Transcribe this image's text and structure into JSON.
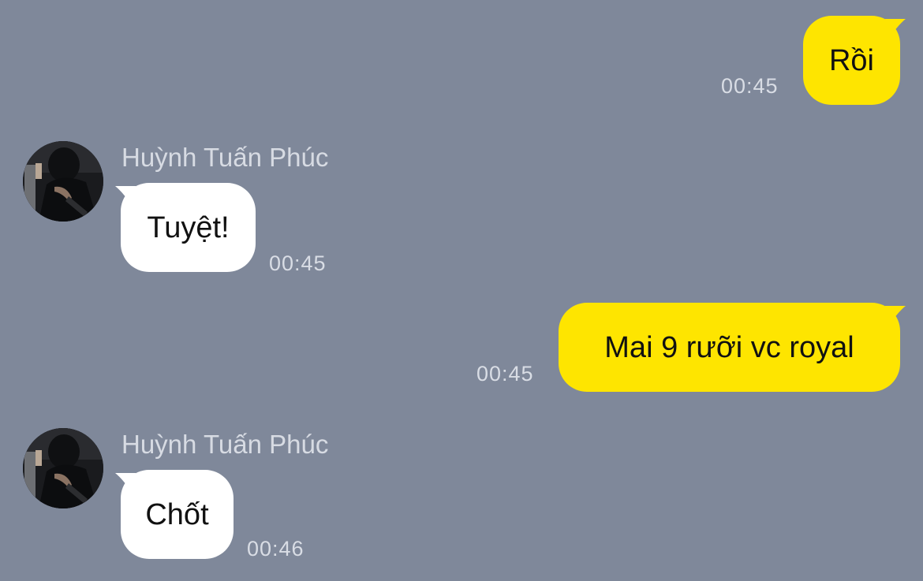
{
  "colors": {
    "background": "#7f889a",
    "outgoing_bubble": "#fee500",
    "incoming_bubble": "#ffffff",
    "text": "#111111",
    "meta_text": "#d9dde5"
  },
  "messages": [
    {
      "direction": "outgoing",
      "text": "Rồi",
      "time": "00:45"
    },
    {
      "direction": "incoming",
      "sender": "Huỳnh Tuấn Phúc",
      "text": "Tuyệt!",
      "time": "00:45"
    },
    {
      "direction": "outgoing",
      "text": "Mai 9 rưỡi vc royal",
      "time": "00:45"
    },
    {
      "direction": "incoming",
      "sender": "Huỳnh Tuấn Phúc",
      "text": "Chốt",
      "time": "00:46"
    }
  ],
  "icons": {
    "avatar": "profile-photo"
  }
}
